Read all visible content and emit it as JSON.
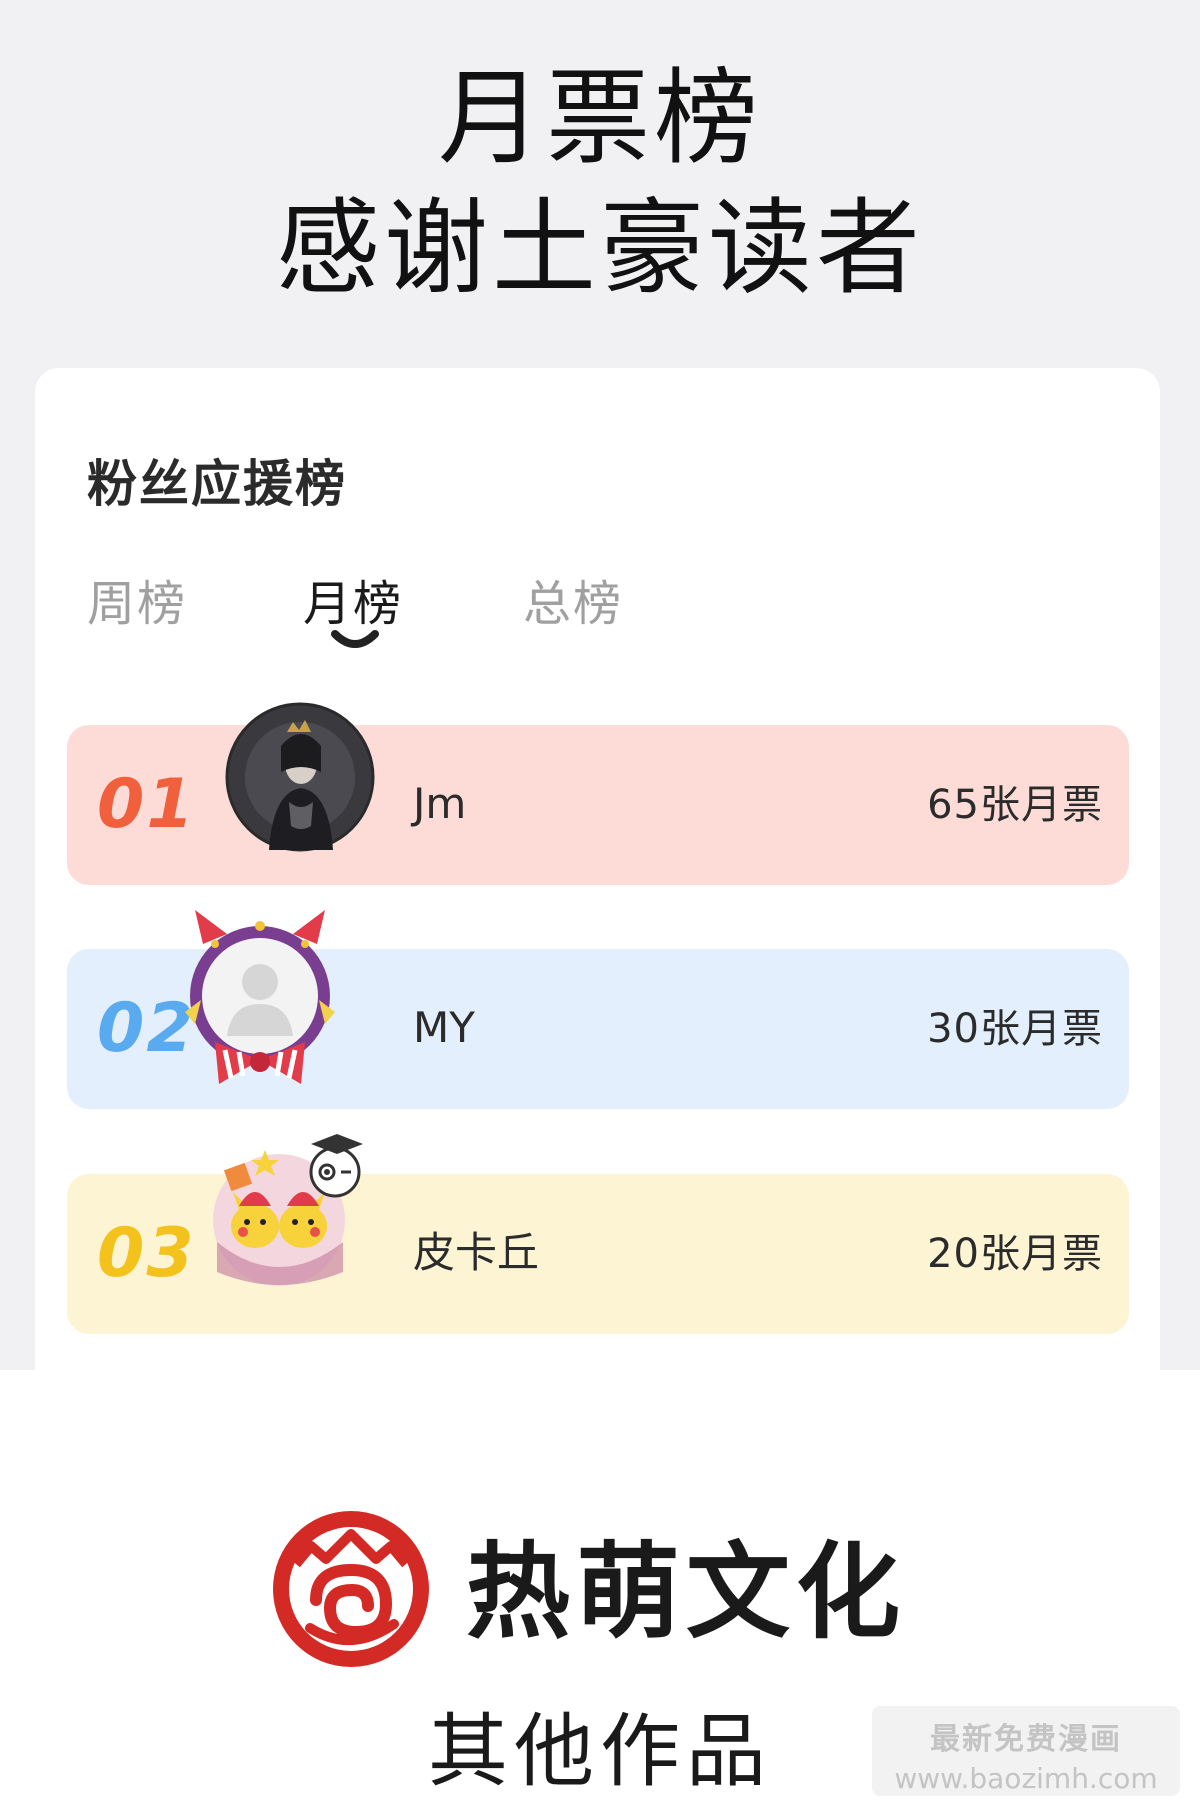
{
  "header": {
    "line1": "月票榜",
    "line2": "感谢土豪读者"
  },
  "card": {
    "title": "粉丝应援榜",
    "tabs": [
      {
        "label": "周榜",
        "active": false
      },
      {
        "label": "月榜",
        "active": true
      },
      {
        "label": "总榜",
        "active": false
      }
    ],
    "rows": [
      {
        "rank": "01",
        "name": "Jm",
        "votes": "65张月票",
        "color": "#fddcd8",
        "rank_color": "#f0603c"
      },
      {
        "rank": "02",
        "name": "MY",
        "votes": "30张月票",
        "color": "#e3effc",
        "rank_color": "#5aaaf0"
      },
      {
        "rank": "03",
        "name": "皮卡丘",
        "votes": "20张月票",
        "color": "#fdf4d4",
        "rank_color": "#f4c21c"
      }
    ]
  },
  "footer": {
    "brand": "热萌文化",
    "other_works": "其他作品",
    "brand_color": "#d42a26"
  },
  "watermark": {
    "line1": "最新免费漫画",
    "line2": "www.baozimh.com"
  }
}
